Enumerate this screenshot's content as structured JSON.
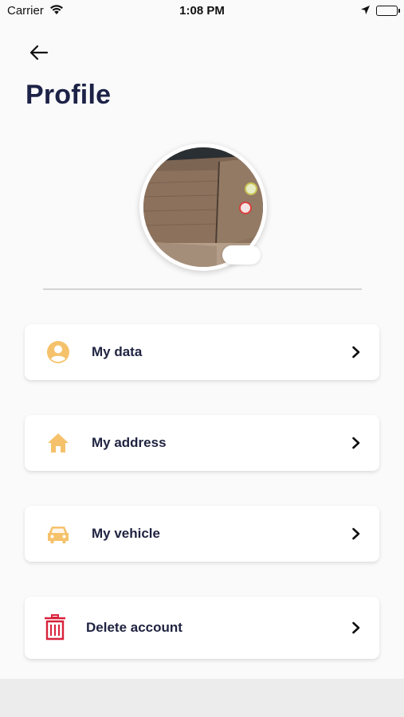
{
  "status_bar": {
    "carrier": "Carrier",
    "time": "1:08 PM"
  },
  "header": {
    "title": "Profile"
  },
  "menu": {
    "items": [
      {
        "label": "My data",
        "icon": "person-icon"
      },
      {
        "label": "My address",
        "icon": "home-icon"
      },
      {
        "label": "My vehicle",
        "icon": "car-icon"
      },
      {
        "label": "Delete account",
        "icon": "trash-icon"
      }
    ]
  },
  "colors": {
    "accent": "#f5c26b",
    "danger": "#d8223a",
    "title": "#1d2247"
  }
}
